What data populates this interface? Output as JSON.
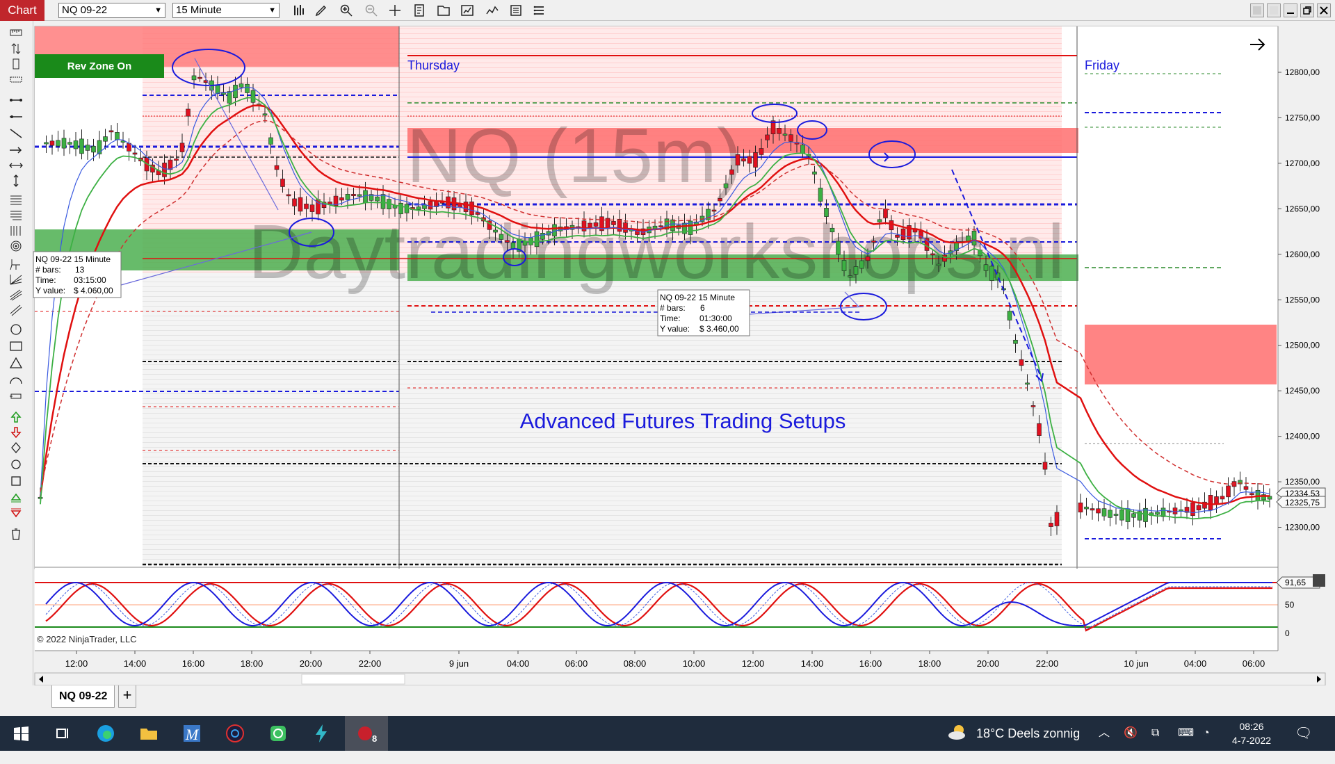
{
  "toolbar": {
    "chart_label": "Chart",
    "instrument": "NQ 09-22",
    "interval": "15 Minute",
    "tools": [
      "bars-icon",
      "pencil-icon",
      "zoom-in-icon",
      "zoom-out-icon",
      "crosshair-icon",
      "properties-icon",
      "templates-icon",
      "strategies-icon",
      "indicators-icon",
      "data-box-icon",
      "chart-trader-icon"
    ]
  },
  "chart": {
    "watermark_symbol": "NQ (15m)",
    "watermark_site": "Daytradingworkshops.nl",
    "rev_zone_label": "Rev Zone On",
    "day_labels": [
      "Thursday",
      "Friday"
    ],
    "setup_text": "Advanced Futures Trading Setups",
    "copyright": "© 2022 NinjaTrader, LLC",
    "price_axis": [
      "12800,00",
      "12750,00",
      "12700,00",
      "12650,00",
      "12600,00",
      "12550,00",
      "12500,00",
      "12450,00",
      "12400,00",
      "12350,00",
      "12300,00"
    ],
    "price_markers": [
      "12334,53",
      "12325,75"
    ],
    "stoch_axis": [
      "50",
      "0"
    ],
    "stoch_marker": "91,65",
    "time_axis": [
      "12:00",
      "14:00",
      "16:00",
      "18:00",
      "20:00",
      "22:00",
      "9 jun",
      "04:00",
      "06:00",
      "08:00",
      "10:00",
      "12:00",
      "14:00",
      "16:00",
      "18:00",
      "20:00",
      "22:00",
      "10 jun",
      "04:00",
      "06:00"
    ],
    "info_box_1": {
      "title": "NQ 09-22 15 Minute",
      "bars_label": "# bars:",
      "bars_value": "13",
      "time_label": "Time:",
      "time_value": "03:15:00",
      "yvalue_label": "Y value:",
      "yvalue_value": "$ 4.060,00"
    },
    "info_box_2": {
      "title": "NQ 09-22 15 Minute",
      "bars_label": "# bars:",
      "bars_value": "6",
      "time_label": "Time:",
      "time_value": "01:30:00",
      "yvalue_label": "Y value:",
      "yvalue_value": "$ 3.460,00"
    },
    "colors": {
      "up": "#3cb043",
      "down": "#e01020",
      "zone_red": "#ff6e6e",
      "zone_green": "#4caf50",
      "blue_line": "#1a1adc",
      "rev_zone": "#1a8a1a"
    }
  },
  "tabs": {
    "active": "NQ 09-22",
    "add": "+"
  },
  "taskbar": {
    "apps": [
      "windows-start-icon",
      "task-view-icon",
      "edge-icon",
      "file-explorer-icon",
      "metastock-icon",
      "app-icon",
      "whatsapp-icon",
      "thunder-icon",
      "ninjatrader-icon"
    ],
    "ninjatrader_badge": "8",
    "weather": "18°C  Deels zonnig",
    "time": "08:26",
    "date": "4-7-2022"
  }
}
